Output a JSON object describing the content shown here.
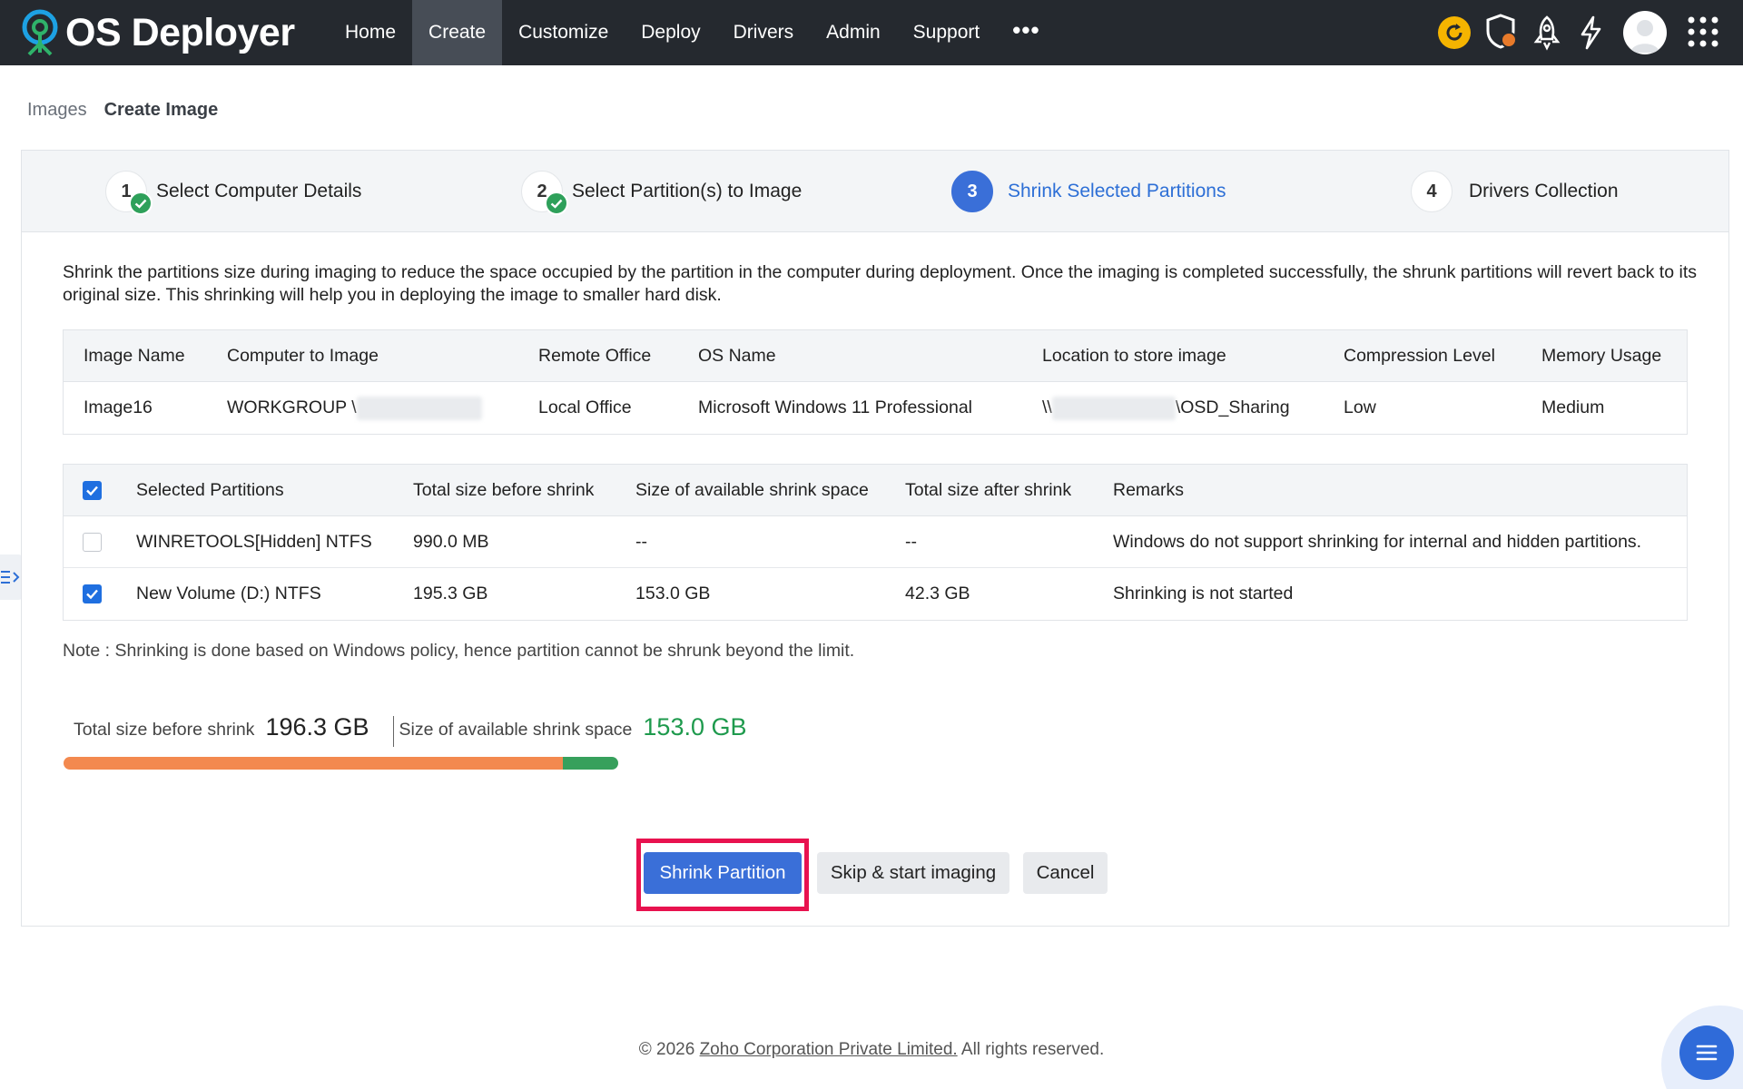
{
  "app": {
    "name": "OS Deployer"
  },
  "nav": {
    "items": [
      "Home",
      "Create",
      "Customize",
      "Deploy",
      "Drivers",
      "Admin",
      "Support"
    ],
    "active": "Create",
    "more": "•••"
  },
  "breadcrumb": {
    "parent": "Images",
    "current": "Create Image"
  },
  "steps": [
    {
      "num": "1",
      "label": "Select Computer Details",
      "status": "completed"
    },
    {
      "num": "2",
      "label": "Select Partition(s) to Image",
      "status": "completed"
    },
    {
      "num": "3",
      "label": "Shrink Selected Partitions",
      "status": "current"
    },
    {
      "num": "4",
      "label": "Drivers Collection",
      "status": "pending"
    }
  ],
  "description": "Shrink the partitions size during imaging to reduce the space occupied by the partition in the computer during deployment. Once the imaging is completed successfully, the shrunk partitions will revert back to its original size. This shrinking will help you in deploying the image to smaller hard disk.",
  "info_table": {
    "headers": [
      "Image Name",
      "Computer to Image",
      "Remote Office",
      "OS Name",
      "Location to store image",
      "Compression Level",
      "Memory Usage"
    ],
    "row": {
      "image_name": "Image16",
      "computer_prefix": "WORKGROUP \\",
      "remote_office": "Local Office",
      "os_name": "Microsoft Windows 11 Professional",
      "location_prefix": "\\\\",
      "location_suffix": "\\OSD_Sharing",
      "compression": "Low",
      "memory": "Medium"
    }
  },
  "partition_table": {
    "headers": [
      "Selected Partitions",
      "Total size before shrink",
      "Size of available shrink space",
      "Total size after shrink",
      "Remarks"
    ],
    "header_checked": true,
    "rows": [
      {
        "checked": false,
        "partition": "WINRETOOLS[Hidden] NTFS",
        "before": "990.0 MB",
        "available": "--",
        "after": "--",
        "remarks": "Windows do not support shrinking for internal and hidden partitions."
      },
      {
        "checked": true,
        "partition": "New Volume (D:) NTFS",
        "before": "195.3 GB",
        "available": "153.0 GB",
        "after": "42.3 GB",
        "remarks": "Shrinking is not started"
      }
    ]
  },
  "note": "Note : Shrinking is done based on Windows policy, hence partition cannot be shrunk beyond the limit.",
  "summary": {
    "total_label": "Total size before shrink",
    "total_value": "196.3 GB",
    "available_label": "Size of available shrink space",
    "available_value": "153.0 GB",
    "bar_used_fraction": 0.9,
    "bar_available_fraction": 0.1
  },
  "buttons": {
    "shrink": "Shrink Partition",
    "skip": "Skip & start imaging",
    "cancel": "Cancel"
  },
  "footer": {
    "prefix": "© 2026 ",
    "link": "Zoho Corporation Private Limited.",
    "suffix": " All rights reserved."
  },
  "colors": {
    "topbar": "#25292f",
    "primary": "#3a6fd8",
    "success": "#2ea05a",
    "highlight": "#e8124f",
    "bar_orange": "#f3894f",
    "bar_green": "#37a05c"
  },
  "icons": [
    "refresh-icon",
    "shield-icon",
    "rocket-icon",
    "lightning-icon",
    "avatar",
    "apps-grid-icon",
    "help-menu-icon",
    "side-panel-toggle-icon"
  ]
}
